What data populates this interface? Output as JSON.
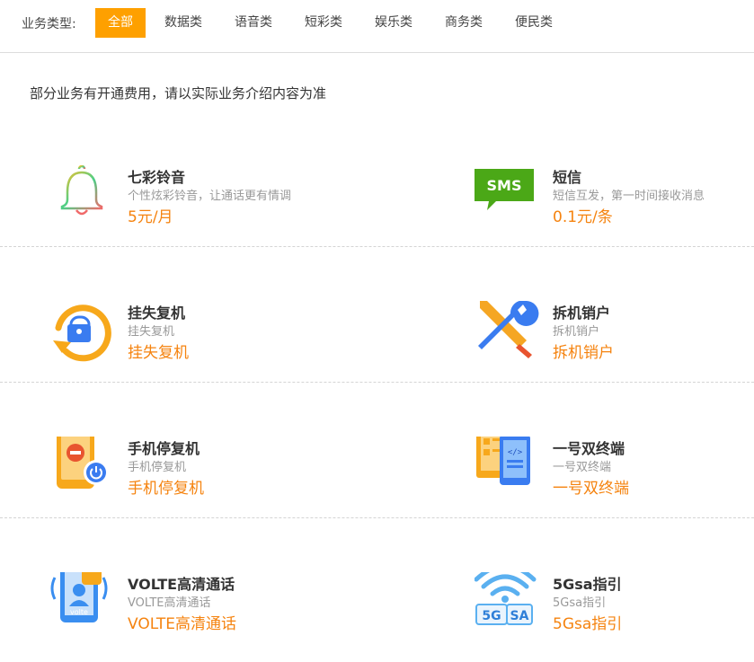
{
  "filter": {
    "label": "业务类型:",
    "tabs": [
      "全部",
      "数据类",
      "语音类",
      "短彩类",
      "娱乐类",
      "商务类",
      "便民类"
    ],
    "active_index": 0
  },
  "notice": "部分业务有开通费用，请以实际业务介绍内容为准",
  "services": [
    {
      "title": "七彩铃音",
      "desc": "个性炫彩铃音，让通话更有情调",
      "price": "5元/月",
      "icon": "bell-icon"
    },
    {
      "title": "短信",
      "desc": "短信互发，第一时间接收消息",
      "price": "0.1元/条",
      "icon": "sms-icon",
      "icon_text": "SMS"
    },
    {
      "title": "挂失复机",
      "desc": "挂失复机",
      "price": "挂失复机",
      "icon": "lock-refresh-icon"
    },
    {
      "title": "拆机销户",
      "desc": "拆机销户",
      "price": "拆机销户",
      "icon": "wrench-screwdriver-icon"
    },
    {
      "title": "手机停复机",
      "desc": "手机停复机",
      "price": "手机停复机",
      "icon": "phone-power-icon"
    },
    {
      "title": "一号双终端",
      "desc": "一号双终端",
      "price": "一号双终端",
      "icon": "dual-device-icon"
    },
    {
      "title": "VOLTE高清通话",
      "desc": "VOLTE高清通话",
      "price": "VOLTE高清通话",
      "icon": "volte-phone-icon",
      "icon_text": "volte"
    },
    {
      "title": "5Gsa指引",
      "desc": "5Gsa指引",
      "price": "5Gsa指引",
      "icon": "5g-wifi-icon",
      "icon_text_1": "5G",
      "icon_text_2": "SA"
    }
  ],
  "colors": {
    "accent": "#fea000",
    "price": "#f5830f"
  }
}
